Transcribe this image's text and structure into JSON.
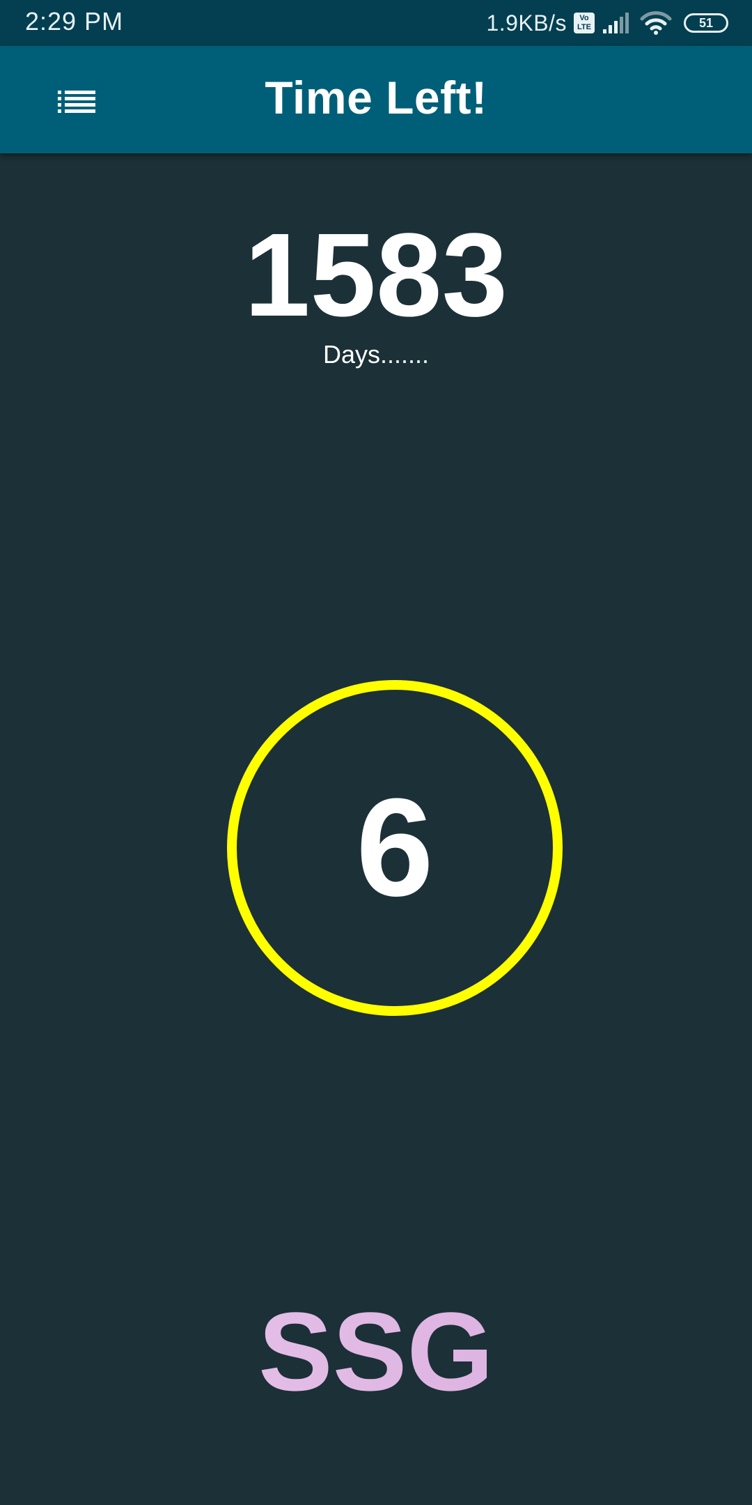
{
  "status_bar": {
    "time": "2:29 PM",
    "net_speed": "1.9KB/s",
    "volte_label_top": "Vo",
    "volte_label_bottom": "LTE",
    "battery_level": "51",
    "icons": [
      "volte-icon",
      "signal-icon",
      "wifi-icon",
      "battery-icon"
    ]
  },
  "app_bar": {
    "title": "Time Left!",
    "menu_icon": "list-icon"
  },
  "countdown": {
    "days": "1583",
    "days_label": "Days.......",
    "counter": "6"
  },
  "brand": {
    "text": "SSG"
  },
  "colors": {
    "status_bar_bg": "#033f50",
    "app_bar_bg": "#005f78",
    "screen_bg": "#1c3037",
    "circle_stroke": "#ffff00",
    "brand_gradient_start": "#e9c9ec",
    "brand_gradient_end": "#d8a8dc"
  }
}
